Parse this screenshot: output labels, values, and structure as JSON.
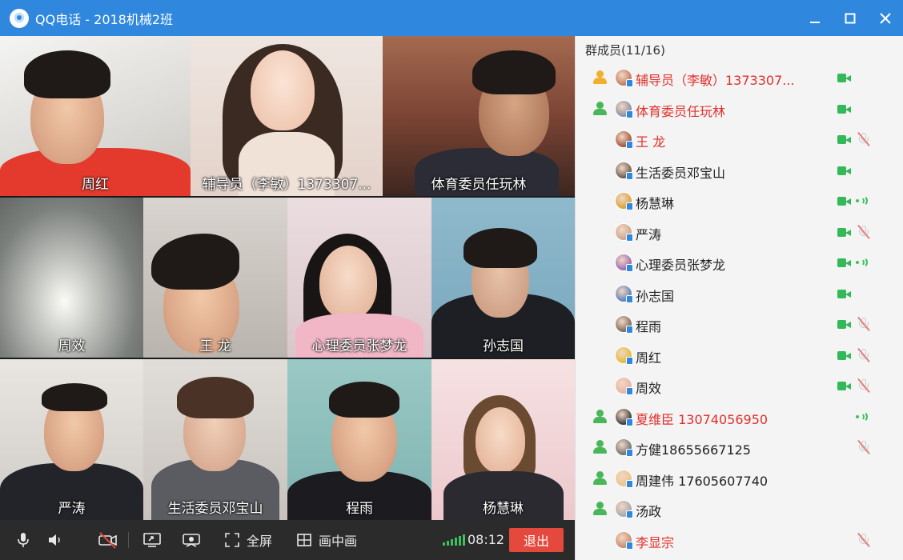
{
  "window": {
    "title": "QQ电话 - 2018机械2班",
    "minimize_icon": "minimize-icon",
    "maximize_icon": "maximize-icon",
    "close_icon": "close-icon"
  },
  "colors": {
    "titlebar": "#2f87de",
    "exit_button": "#e5483d",
    "highlight_name": "#e0302b",
    "camera_on": "#33b85a",
    "signal": "#3bc25e"
  },
  "video_tiles": [
    {
      "name": "周红"
    },
    {
      "name": "辅导员（李敏）1373307..."
    },
    {
      "name": "体育委员任玩林"
    },
    {
      "name": "周效"
    },
    {
      "name": "王  龙"
    },
    {
      "name": "心理委员张梦龙"
    },
    {
      "name": "孙志国"
    },
    {
      "name": "严涛"
    },
    {
      "name": "生活委员邓宝山"
    },
    {
      "name": "程雨"
    },
    {
      "name": "杨慧琳"
    }
  ],
  "toolbar": {
    "mic_icon": "microphone-icon",
    "speaker_icon": "speaker-icon",
    "camera_off_icon": "camera-off-icon",
    "screen_share_icon": "screen-share-icon",
    "camera_switch_icon": "camera-switch-icon",
    "fullscreen_label": "全屏",
    "pip_label": "画中画",
    "duration": "08:12",
    "exit_label": "退出"
  },
  "members": {
    "header": "群成员(11/16)",
    "list": [
      {
        "name": "辅导员（李敏）1373307...",
        "red": true,
        "role": "admin-gold",
        "camera": true,
        "mic": "none"
      },
      {
        "name": "体育委员任玩林",
        "red": true,
        "role": "admin-green",
        "camera": true,
        "mic": "none"
      },
      {
        "name": "王  龙",
        "red": true,
        "role": "none",
        "camera": true,
        "mic": "muted"
      },
      {
        "name": "生活委员邓宝山",
        "red": false,
        "role": "none",
        "camera": true,
        "mic": "none"
      },
      {
        "name": "杨慧琳",
        "red": false,
        "role": "none",
        "camera": true,
        "mic": "speaking"
      },
      {
        "name": "严涛",
        "red": false,
        "role": "none",
        "camera": true,
        "mic": "muted"
      },
      {
        "name": "心理委员张梦龙",
        "red": false,
        "role": "none",
        "camera": true,
        "mic": "speaking"
      },
      {
        "name": "孙志国",
        "red": false,
        "role": "none",
        "camera": true,
        "mic": "none"
      },
      {
        "name": "程雨",
        "red": false,
        "role": "none",
        "camera": true,
        "mic": "muted"
      },
      {
        "name": "周红",
        "red": false,
        "role": "none",
        "camera": true,
        "mic": "muted"
      },
      {
        "name": "周效",
        "red": false,
        "role": "none",
        "camera": true,
        "mic": "muted"
      },
      {
        "name": "夏维臣   13074056950",
        "red": true,
        "role": "admin-green",
        "camera": false,
        "mic": "speaking"
      },
      {
        "name": "方健18655667125",
        "red": false,
        "role": "admin-green",
        "camera": false,
        "mic": "muted"
      },
      {
        "name": "周建伟 17605607740",
        "red": false,
        "role": "admin-green",
        "camera": false,
        "mic": "none"
      },
      {
        "name": "汤政",
        "red": false,
        "role": "admin-green",
        "camera": false,
        "mic": "none"
      },
      {
        "name": "李显宗",
        "red": true,
        "role": "none",
        "camera": false,
        "mic": "muted"
      }
    ]
  }
}
